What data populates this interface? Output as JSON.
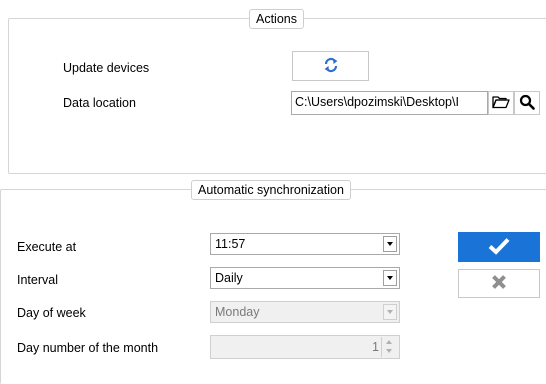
{
  "actions": {
    "title": "Actions",
    "update_devices_label": "Update devices",
    "data_location_label": "Data location",
    "data_location_value": "C:\\Users\\dpozimski\\Desktop\\I",
    "refresh_icon": "refresh-icon",
    "folder_icon": "folder-open-icon",
    "search_icon": "search-icon"
  },
  "sync": {
    "title": "Automatic synchronization",
    "execute_at_label": "Execute at",
    "execute_at_value": "11:57",
    "interval_label": "Interval",
    "interval_value": "Daily",
    "day_of_week_label": "Day of week",
    "day_of_week_value": "Monday",
    "day_number_label": "Day number of the month",
    "day_number_value": "1",
    "confirm_icon": "checkmark-icon",
    "cancel_icon": "close-icon"
  },
  "colors": {
    "accent": "#1a74d8",
    "refresh_icon": "#2f6fcc",
    "cancel_icon": "#8f8f8f",
    "group_border": "#d5d5d5"
  }
}
